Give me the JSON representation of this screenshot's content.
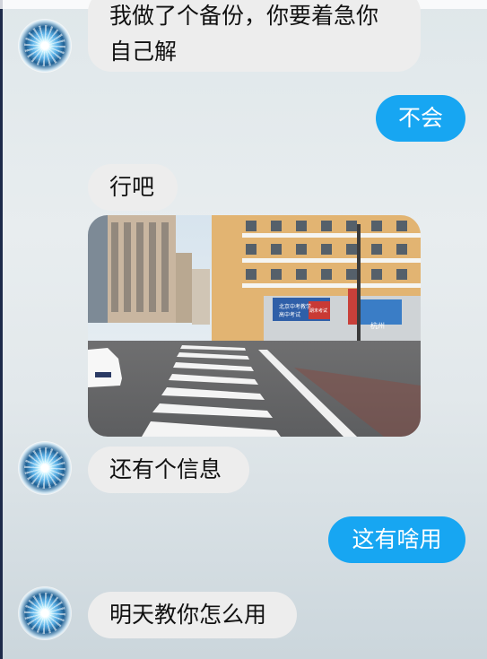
{
  "chat": {
    "messages": [
      {
        "side": "in",
        "text": "我做了个备份，你要着急你自己解"
      },
      {
        "side": "out",
        "text": "不会"
      },
      {
        "side": "in",
        "text": "行吧"
      },
      {
        "side": "in",
        "type": "image"
      },
      {
        "side": "in",
        "text": "还有个信息"
      },
      {
        "side": "out",
        "text": "这有啥用"
      },
      {
        "side": "in",
        "text": "明天教你怎么用"
      }
    ],
    "photo_signs": {
      "blue_board_line1": "北京中考教学",
      "blue_board_line2": "高中考试",
      "red_board": "期末考试",
      "store_sign": "杭州"
    }
  }
}
